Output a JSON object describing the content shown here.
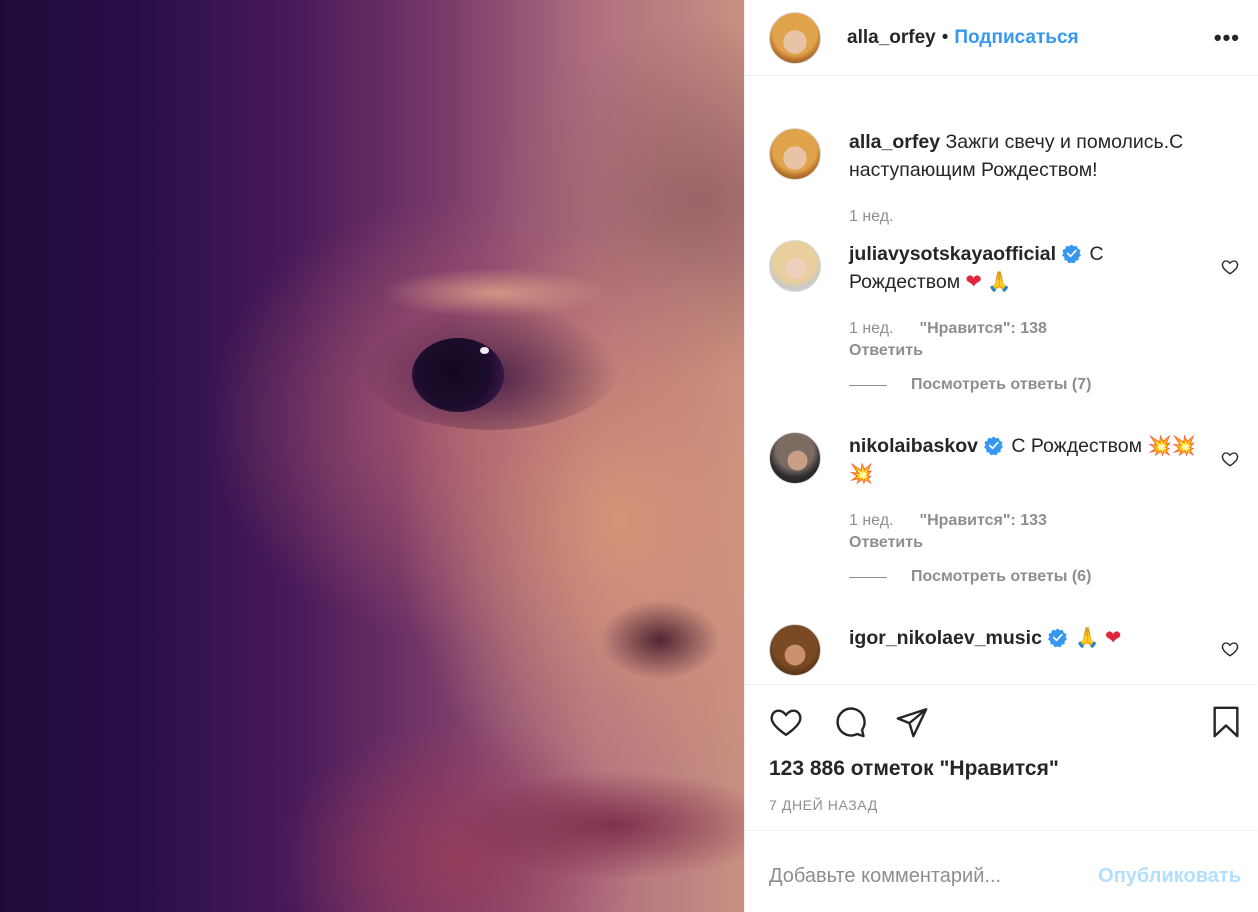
{
  "post": {
    "author": "alla_orfey",
    "separator": "•",
    "follow_label": "Подписаться",
    "more_icon": "more-horizontal-icon",
    "caption": {
      "username": "alla_orfey",
      "text": "Зажги свечу и помолись.С наступающим Рождеством!",
      "time": "1 нед."
    }
  },
  "comments": [
    {
      "username": "juliavysotskayaofficial",
      "verified": true,
      "text": "С Рождеством",
      "emoji": [
        "❤",
        "🙏"
      ],
      "time": "1 нед.",
      "likes": "\"Нравится\": 138",
      "reply_label": "Ответить",
      "view_replies": "Посмотреть ответы (7)"
    },
    {
      "username": "nikolaibaskov",
      "verified": true,
      "text": "С Рождеством",
      "emoji": [
        "💥",
        "💥",
        "💥"
      ],
      "time": "1 нед.",
      "likes": "\"Нравится\": 133",
      "reply_label": "Ответить",
      "view_replies": "Посмотреть ответы (6)"
    },
    {
      "username": "igor_nikolaev_music",
      "verified": true,
      "text": "",
      "emoji": [
        "🙏",
        "❤"
      ]
    }
  ],
  "actions": {
    "like_icon": "heart-outline-icon",
    "comment_icon": "comment-bubble-icon",
    "share_icon": "paper-plane-icon",
    "save_icon": "bookmark-icon",
    "likes_count": "123 886 отметок \"Нравится\"",
    "time_ago": "7 ДНЕЙ НАЗАД"
  },
  "add_comment": {
    "placeholder": "Добавьте комментарий...",
    "publish_label": "Опубликовать"
  },
  "colors": {
    "link_blue": "#3897f0",
    "publish_disabled": "#b2dffc",
    "muted": "#8e8e8e",
    "verified_blue": "#3897f0",
    "heart_red": "#e0263b"
  }
}
